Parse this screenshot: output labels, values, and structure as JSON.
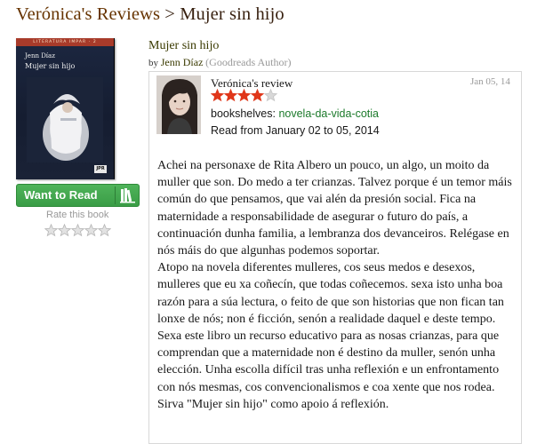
{
  "breadcrumb": {
    "parent": "Verónica's Reviews",
    "separator": ">",
    "current": "Mujer sin hijo"
  },
  "book": {
    "cover": {
      "series": "LITERATURA IMPAR · 2",
      "author": "Jenn Díaz",
      "title": "Mujer sin hijo",
      "publisher_mark": "JPR"
    },
    "title": "Mujer sin hijo",
    "by": "by",
    "author": "Jenn Díaz",
    "author_note": "(Goodreads Author)"
  },
  "shelf_button": {
    "label": "Want to Read",
    "icon": "books-icon"
  },
  "rating_widget": {
    "label": "Rate this book",
    "stars": 5,
    "rating": 0
  },
  "review": {
    "user_label": "Verónica's review",
    "date": "Jan 05, 14",
    "rating": 4,
    "max_rating": 5,
    "bookshelves_label": "bookshelves:",
    "bookshelf": "novela-da-vida-cotia",
    "read_dates": "Read from January 02 to 05, 2014",
    "paragraphs": [
      "Achei na personaxe de Rita Albero un pouco, un algo, un moito da muller que son. Do medo a ter crianzas. Talvez porque é un temor máis común do que pensamos, que vai alén da presión social. Fica na maternidade a responsabilidade de asegurar o futuro do país, a continuación dunha familia, a lembranza dos devanceiros. Relégase en nós máis do que algunhas podemos soportar.",
      "Atopo na novela diferentes mulleres, cos seus medos e desexos, mulleres que eu xa coñecín, que todas coñecemos. sexa isto unha boa razón para a súa lectura, o feito de que son historias que non fican tan lonxe de nós; non é ficción, senón a realidade daquel e deste tempo. Sexa este libro un recurso educativo para as nosas crianzas, para que comprendan que a maternidade non é destino da muller, senón unha elección. Unha escolla difícil tras unha reflexión e un enfrontamento con nós mesmas, cos convencionalismos e coa xente que nos rodea. Sirva \"Mujer sin hijo\" como apoio á reflexión."
    ]
  },
  "colors": {
    "brand_brown": "#382110",
    "shelf_green": "#409d49",
    "star_red": "#e0371a",
    "link_green": "#1c7a2b",
    "muted_grey": "#999999"
  }
}
